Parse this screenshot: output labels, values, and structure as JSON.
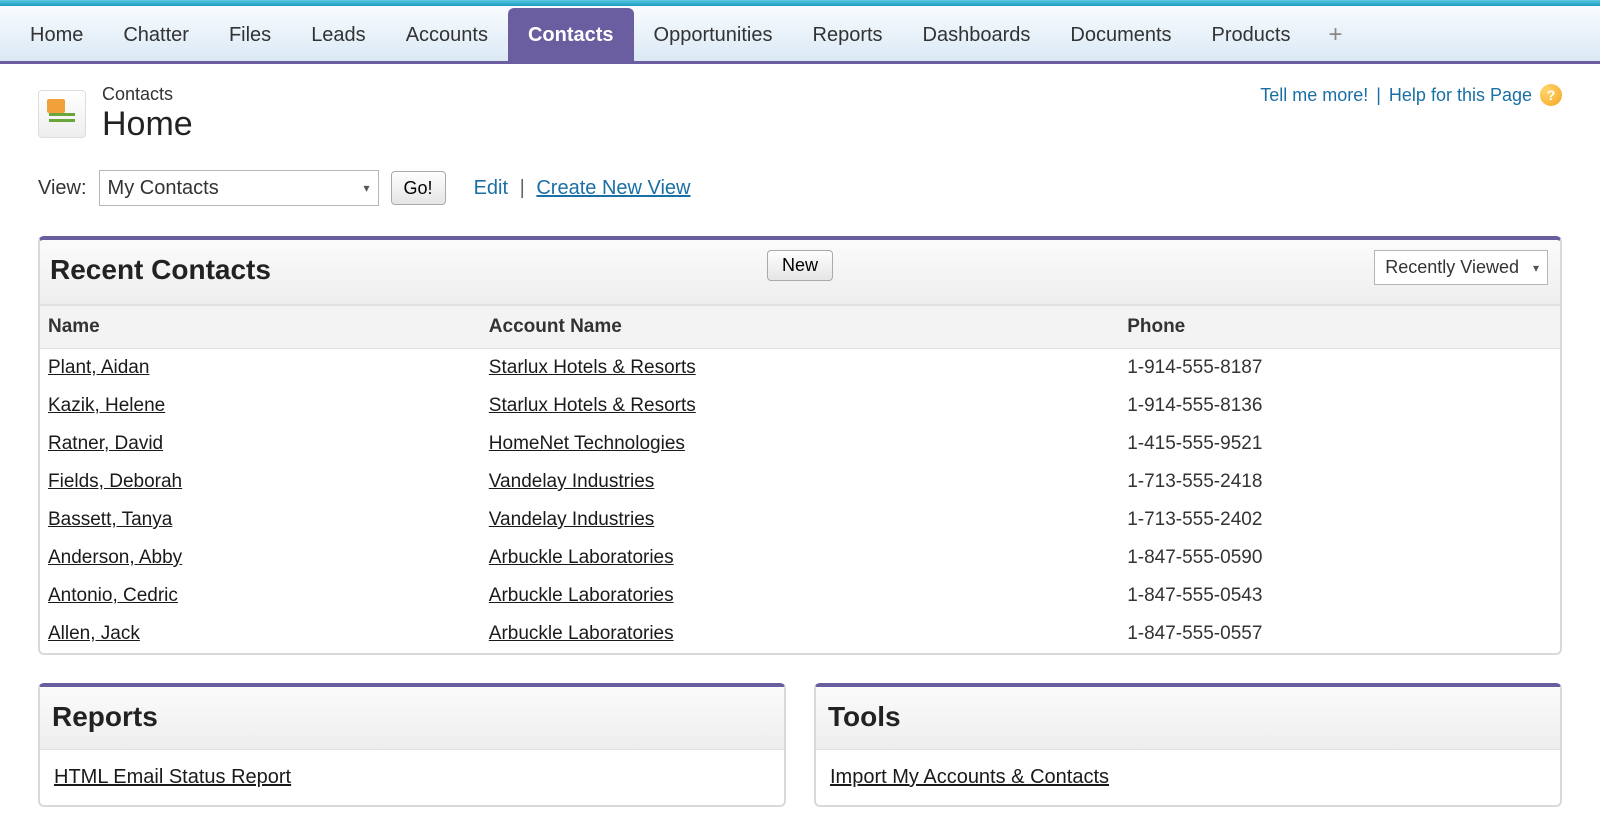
{
  "nav": {
    "tabs": [
      "Home",
      "Chatter",
      "Files",
      "Leads",
      "Accounts",
      "Contacts",
      "Opportunities",
      "Reports",
      "Dashboards",
      "Documents",
      "Products"
    ],
    "active": "Contacts"
  },
  "header": {
    "subtitle": "Contacts",
    "title": "Home",
    "tell_more": "Tell me more!",
    "help_page": "Help for this Page"
  },
  "view": {
    "label": "View:",
    "selected": "My Contacts",
    "go": "Go!",
    "edit": "Edit",
    "create": "Create New View"
  },
  "recent": {
    "title": "Recent Contacts",
    "new_btn": "New",
    "filter": "Recently Viewed",
    "columns": {
      "name": "Name",
      "account": "Account Name",
      "phone": "Phone"
    },
    "rows": [
      {
        "name": "Plant, Aidan",
        "account": "Starlux Hotels & Resorts",
        "phone": "1-914-555-8187"
      },
      {
        "name": "Kazik, Helene",
        "account": "Starlux Hotels & Resorts",
        "phone": "1-914-555-8136"
      },
      {
        "name": "Ratner, David",
        "account": "HomeNet Technologies",
        "phone": "1-415-555-9521"
      },
      {
        "name": "Fields, Deborah",
        "account": "Vandelay Industries",
        "phone": "1-713-555-2418"
      },
      {
        "name": "Bassett, Tanya",
        "account": "Vandelay Industries",
        "phone": "1-713-555-2402"
      },
      {
        "name": "Anderson, Abby",
        "account": "Arbuckle Laboratories",
        "phone": "1-847-555-0590"
      },
      {
        "name": "Antonio, Cedric",
        "account": "Arbuckle Laboratories",
        "phone": "1-847-555-0543"
      },
      {
        "name": "Allen, Jack",
        "account": "Arbuckle Laboratories",
        "phone": "1-847-555-0557"
      }
    ]
  },
  "reports": {
    "title": "Reports",
    "links": [
      "HTML Email Status Report"
    ]
  },
  "tools": {
    "title": "Tools",
    "links": [
      "Import My Accounts & Contacts"
    ]
  }
}
